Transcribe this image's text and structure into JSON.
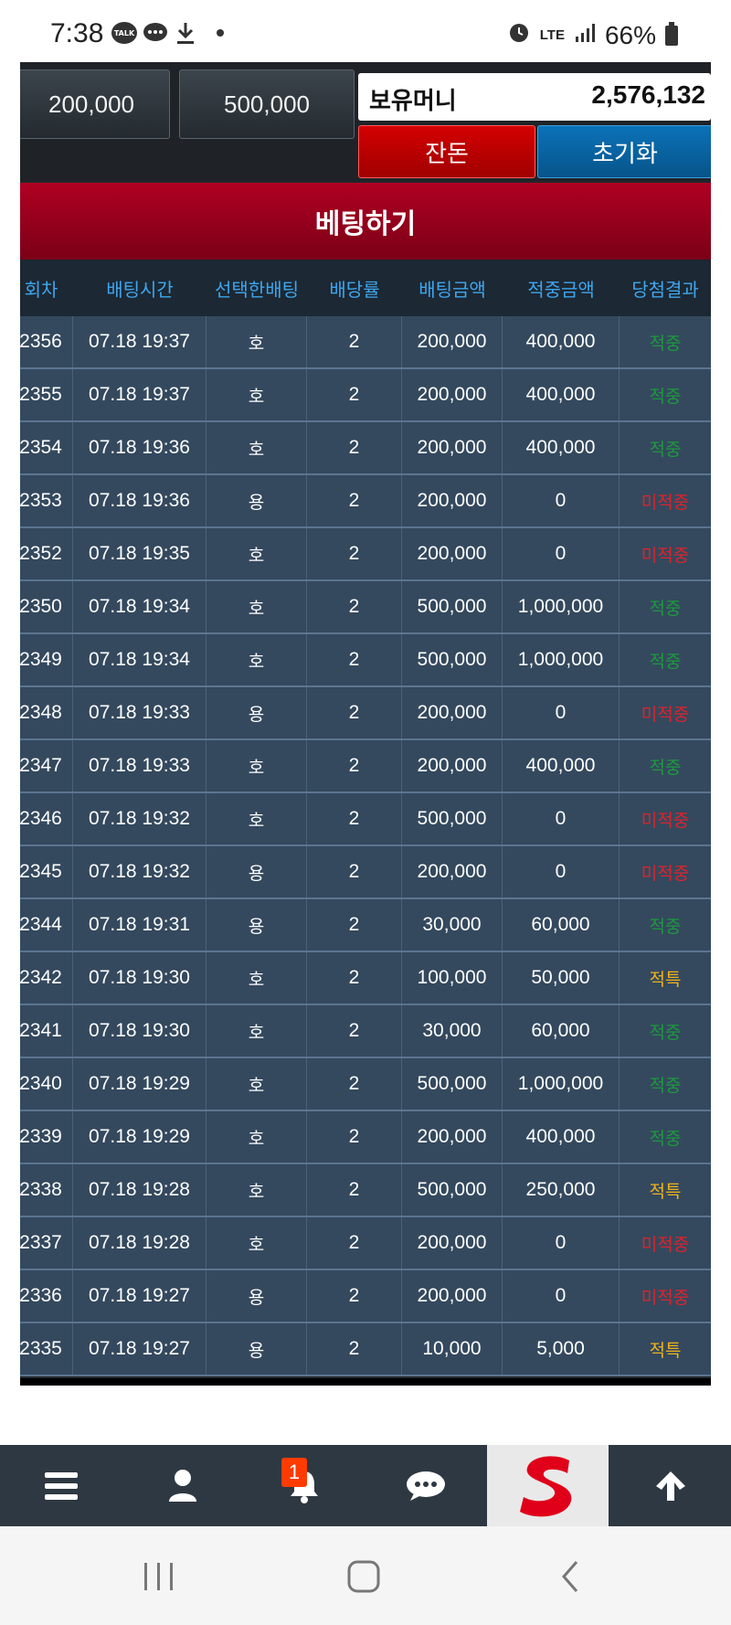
{
  "status_bar": {
    "time": "7:38",
    "talk_icon_text": "TALK",
    "network": "LTE",
    "battery": "66%"
  },
  "top_panel": {
    "chip_1": "200,000",
    "chip_2": "500,000",
    "money_label": "보유머니",
    "money_value": "2,576,132",
    "change_button": "잔돈",
    "reset_button": "초기화"
  },
  "banner": {
    "title": "베팅하기"
  },
  "table": {
    "headers": [
      "회차",
      "배팅시간",
      "선택한배팅",
      "배당률",
      "배팅금액",
      "적중금액",
      "당첨결과"
    ],
    "rows": [
      {
        "round": "2356",
        "time": "07.18 19:37",
        "pick": "호",
        "odds": "2",
        "bet": "200,000",
        "win": "400,000",
        "result": "적중",
        "status": "win"
      },
      {
        "round": "2355",
        "time": "07.18 19:37",
        "pick": "호",
        "odds": "2",
        "bet": "200,000",
        "win": "400,000",
        "result": "적중",
        "status": "win"
      },
      {
        "round": "2354",
        "time": "07.18 19:36",
        "pick": "호",
        "odds": "2",
        "bet": "200,000",
        "win": "400,000",
        "result": "적중",
        "status": "win"
      },
      {
        "round": "2353",
        "time": "07.18 19:36",
        "pick": "용",
        "odds": "2",
        "bet": "200,000",
        "win": "0",
        "result": "미적중",
        "status": "lose"
      },
      {
        "round": "2352",
        "time": "07.18 19:35",
        "pick": "호",
        "odds": "2",
        "bet": "200,000",
        "win": "0",
        "result": "미적중",
        "status": "lose"
      },
      {
        "round": "2350",
        "time": "07.18 19:34",
        "pick": "호",
        "odds": "2",
        "bet": "500,000",
        "win": "1,000,000",
        "result": "적중",
        "status": "win"
      },
      {
        "round": "2349",
        "time": "07.18 19:34",
        "pick": "호",
        "odds": "2",
        "bet": "500,000",
        "win": "1,000,000",
        "result": "적중",
        "status": "win"
      },
      {
        "round": "2348",
        "time": "07.18 19:33",
        "pick": "용",
        "odds": "2",
        "bet": "200,000",
        "win": "0",
        "result": "미적중",
        "status": "lose"
      },
      {
        "round": "2347",
        "time": "07.18 19:33",
        "pick": "호",
        "odds": "2",
        "bet": "200,000",
        "win": "400,000",
        "result": "적중",
        "status": "win"
      },
      {
        "round": "2346",
        "time": "07.18 19:32",
        "pick": "호",
        "odds": "2",
        "bet": "500,000",
        "win": "0",
        "result": "미적중",
        "status": "lose"
      },
      {
        "round": "2345",
        "time": "07.18 19:32",
        "pick": "용",
        "odds": "2",
        "bet": "200,000",
        "win": "0",
        "result": "미적중",
        "status": "lose"
      },
      {
        "round": "2344",
        "time": "07.18 19:31",
        "pick": "용",
        "odds": "2",
        "bet": "30,000",
        "win": "60,000",
        "result": "적중",
        "status": "win"
      },
      {
        "round": "2342",
        "time": "07.18 19:30",
        "pick": "호",
        "odds": "2",
        "bet": "100,000",
        "win": "50,000",
        "result": "적특",
        "status": "special"
      },
      {
        "round": "2341",
        "time": "07.18 19:30",
        "pick": "호",
        "odds": "2",
        "bet": "30,000",
        "win": "60,000",
        "result": "적중",
        "status": "win"
      },
      {
        "round": "2340",
        "time": "07.18 19:29",
        "pick": "호",
        "odds": "2",
        "bet": "500,000",
        "win": "1,000,000",
        "result": "적중",
        "status": "win"
      },
      {
        "round": "2339",
        "time": "07.18 19:29",
        "pick": "호",
        "odds": "2",
        "bet": "200,000",
        "win": "400,000",
        "result": "적중",
        "status": "win"
      },
      {
        "round": "2338",
        "time": "07.18 19:28",
        "pick": "호",
        "odds": "2",
        "bet": "500,000",
        "win": "250,000",
        "result": "적특",
        "status": "special"
      },
      {
        "round": "2337",
        "time": "07.18 19:28",
        "pick": "호",
        "odds": "2",
        "bet": "200,000",
        "win": "0",
        "result": "미적중",
        "status": "lose"
      },
      {
        "round": "2336",
        "time": "07.18 19:27",
        "pick": "용",
        "odds": "2",
        "bet": "200,000",
        "win": "0",
        "result": "미적중",
        "status": "lose"
      },
      {
        "round": "2335",
        "time": "07.18 19:27",
        "pick": "용",
        "odds": "2",
        "bet": "10,000",
        "win": "5,000",
        "result": "적특",
        "status": "special"
      }
    ]
  },
  "bottom_nav": {
    "items": [
      "menu-icon",
      "user-icon",
      "bell-icon",
      "chat-icon",
      "logo",
      "arrow-up-icon"
    ],
    "notification_count": "1"
  },
  "colors": {
    "win": "#1c9a3c",
    "lose": "#e0222b",
    "special": "#f1b219",
    "header_text": "#3ea6ef",
    "row_bg": "#34495e"
  }
}
